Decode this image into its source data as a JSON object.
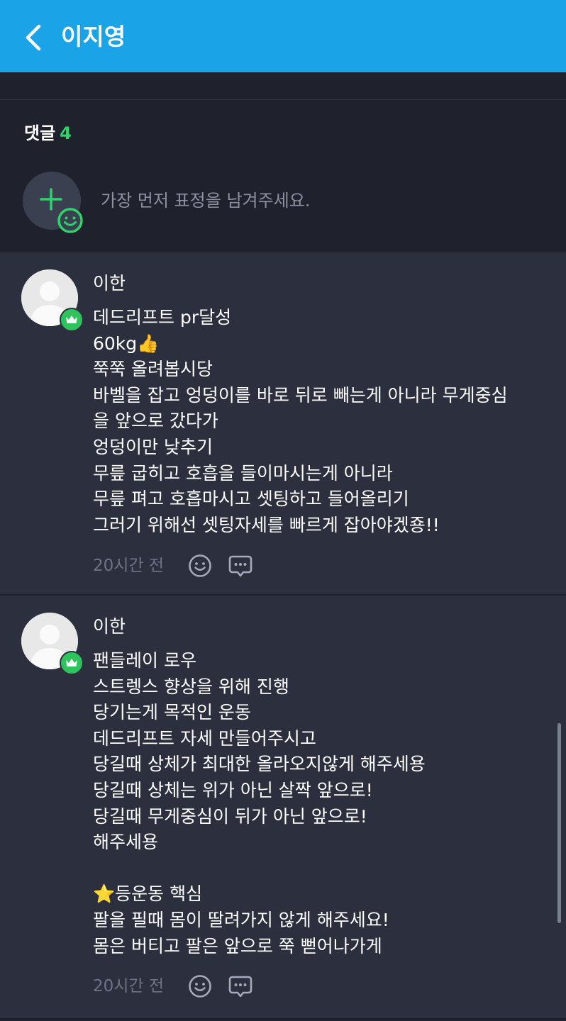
{
  "header": {
    "title": "이지영"
  },
  "comments_section": {
    "label": "댓글",
    "count": "4",
    "reaction_prompt": "가장 먼저 표정을 남겨주세요."
  },
  "comments": [
    {
      "author": "이한",
      "lines": [
        "데드리프트 pr달성",
        "60kg👍",
        "쭉쭉 올려봅시당",
        "바벨을 잡고 엉덩이를 바로 뒤로 빼는게 아니라 무게중심",
        "을 앞으로 갔다가",
        "엉덩이만 낮추기",
        "무릎 굽히고 호흡을 들이마시는게 아니라",
        "무릎 펴고 호흡마시고 셋팅하고 들어올리기",
        "그러기 위해선 셋팅자세를 빠르게 잡아야겠죵!!"
      ],
      "time": "20시간 전"
    },
    {
      "author": "이한",
      "lines": [
        "팬들레이 로우",
        "스트렝스 향상을 위해 진행",
        "당기는게 목적인 운동",
        "데드리프트 자세 만들어주시고",
        "당길때 상체가 최대한 올라오지않게 해주세용",
        "당길때 상체는 위가 아닌 살짝 앞으로!",
        "당길때 무게중심이 뒤가 아닌 앞으로!",
        "해주세용",
        "",
        "⭐등운동 핵심",
        "팔을 필때 몸이 딸려가지 않게 해주세요!",
        "몸은 버티고 팔은 앞으로 쭉 뻗어나가게"
      ],
      "time": "20시간 전"
    }
  ],
  "colors": {
    "header_bg": "#1ba3e8",
    "accent_green": "#2fd36b",
    "page_bg": "#2c2f3e",
    "section_bg": "#1f222c"
  }
}
